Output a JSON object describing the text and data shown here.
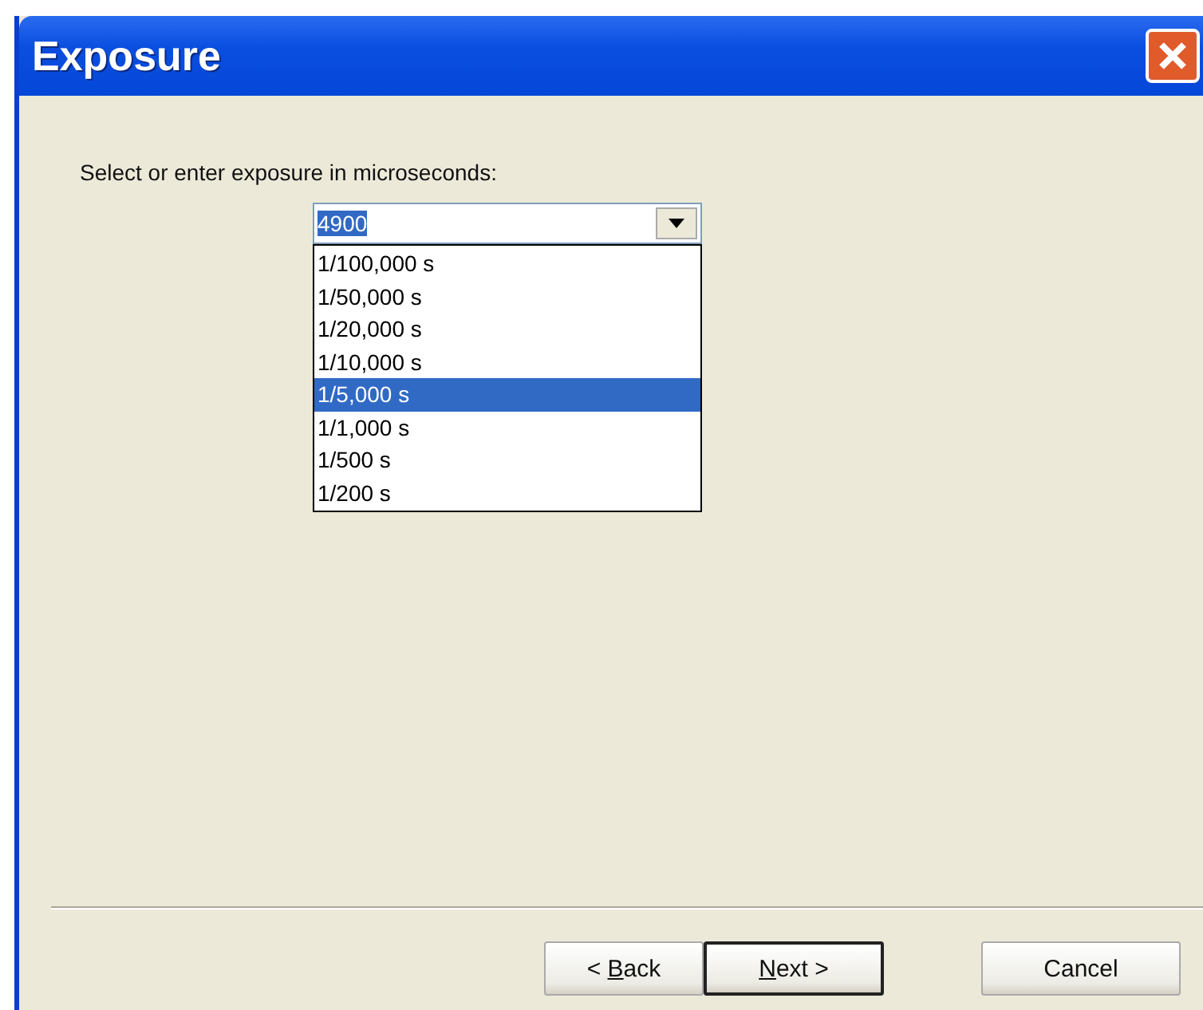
{
  "window": {
    "title": "Exposure"
  },
  "prompt": "Select or enter exposure in microseconds:",
  "combo": {
    "value": "4900",
    "value_selected": true,
    "open": true,
    "options": [
      {
        "label": "1/100,000 s",
        "selected": false
      },
      {
        "label": "1/50,000 s",
        "selected": false
      },
      {
        "label": "1/20,000 s",
        "selected": false
      },
      {
        "label": "1/10,000 s",
        "selected": false
      },
      {
        "label": "1/5,000 s",
        "selected": true
      },
      {
        "label": "1/1,000 s",
        "selected": false
      },
      {
        "label": "1/500 s",
        "selected": false
      },
      {
        "label": "1/200 s",
        "selected": false
      }
    ]
  },
  "buttons": [
    {
      "before": "< ",
      "key": "B",
      "after": "ack",
      "default": false
    },
    {
      "key": "N",
      "after": "ext >",
      "default": true
    },
    {
      "after": "Cancel",
      "default": false
    }
  ]
}
